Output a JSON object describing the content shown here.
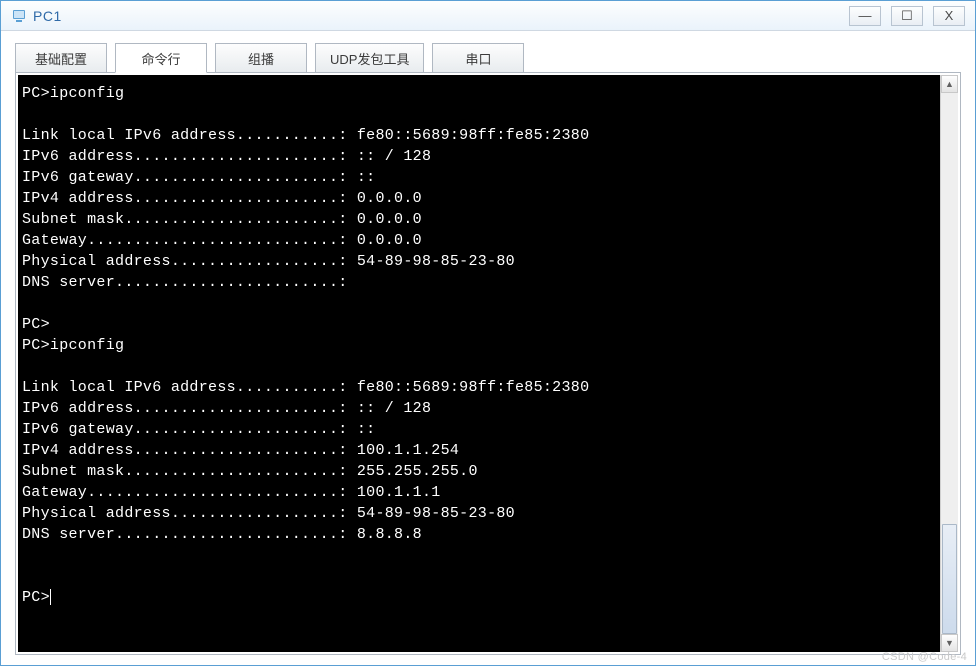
{
  "window": {
    "title": "PC1"
  },
  "tabs": [
    {
      "label": "基础配置"
    },
    {
      "label": "命令行"
    },
    {
      "label": "组播"
    },
    {
      "label": "UDP发包工具"
    },
    {
      "label": "串口"
    }
  ],
  "active_tab_index": 1,
  "terminal": {
    "prompt": "PC>",
    "command": "ipconfig",
    "blocks": [
      {
        "cmd": "ipconfig",
        "lines": [
          "Link local IPv6 address...........: fe80::5689:98ff:fe85:2380",
          "IPv6 address......................: :: / 128",
          "IPv6 gateway......................: ::",
          "IPv4 address......................: 0.0.0.0",
          "Subnet mask.......................: 0.0.0.0",
          "Gateway...........................: 0.0.0.0",
          "Physical address..................: 54-89-98-85-23-80",
          "DNS server........................:"
        ]
      },
      {
        "cmd": "",
        "lines": []
      },
      {
        "cmd": "ipconfig",
        "lines": [
          "Link local IPv6 address...........: fe80::5689:98ff:fe85:2380",
          "IPv6 address......................: :: / 128",
          "IPv6 gateway......................: ::",
          "IPv4 address......................: 100.1.1.254",
          "Subnet mask.......................: 255.255.255.0",
          "Gateway...........................: 100.1.1.1",
          "Physical address..................: 54-89-98-85-23-80",
          "DNS server........................: 8.8.8.8"
        ]
      }
    ]
  },
  "watermark": "CSDN @Code-4",
  "glyphs": {
    "minimize": "—",
    "maximize": "☐",
    "close": "X",
    "arrow_up": "▲",
    "arrow_down": "▼"
  }
}
